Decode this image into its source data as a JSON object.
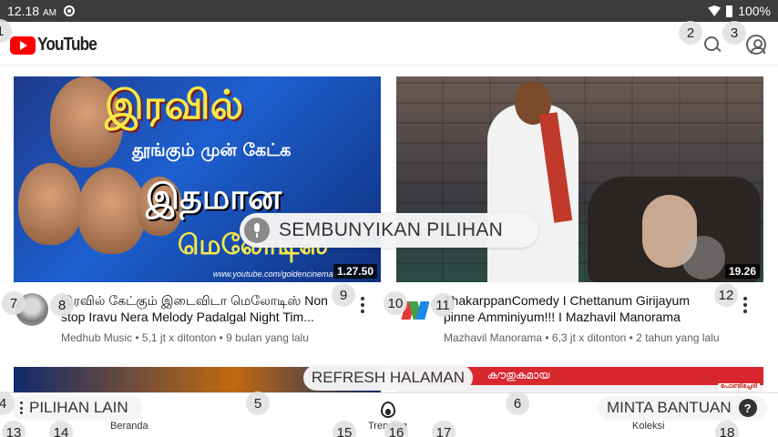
{
  "status_bar": {
    "time": "12.18",
    "ampm": "AM",
    "battery": "100%"
  },
  "app": {
    "logo_text": "YouTube"
  },
  "badges": [
    "1",
    "2",
    "3",
    "4",
    "5",
    "6",
    "7",
    "8",
    "9",
    "10",
    "11",
    "12",
    "13",
    "14",
    "15",
    "16",
    "17",
    "18"
  ],
  "videos": [
    {
      "thumb_title": "இரவில்",
      "thumb_line2": "தூங்கும் முன் கேட்க",
      "thumb_line3": "இதமான",
      "thumb_line4": "மெலோடிஸ்",
      "thumb_url": "www.youtube.com/goldencinemas",
      "duration": "1.27.50",
      "title": "இரவில் கேட்கும் இடைவிடா மெலோடிஸ் Non stop Iravu Nera Melody Padalgal Night Tim...",
      "meta": "Medhub Music • 5,1 jt x ditonton • 9 bulan yang lalu"
    },
    {
      "duration": "19.26",
      "title": "ThakarppanComedy I Chettanum Girijayum pinne Amminiyum!!! I Mazhavil Manorama",
      "meta": "Mazhavil Manorama • 6,3 jt x ditonton • 2 tahun yang lalu"
    }
  ],
  "next_row": {
    "thumb2_text": "കൗതുകമായ",
    "thumb2_tag": "പോണ്ടിച്ചേരി"
  },
  "overlays": {
    "voice_hide": "SEMBUNYIKAN PILIHAN",
    "refresh": "REFRESH HALAMAN",
    "more_options": "PILIHAN LAIN",
    "help": "MINTA BANTUAN",
    "help_glyph": "?"
  },
  "bottom_nav": {
    "home": "Beranda",
    "trending": "Trending",
    "library": "Koleksi"
  }
}
